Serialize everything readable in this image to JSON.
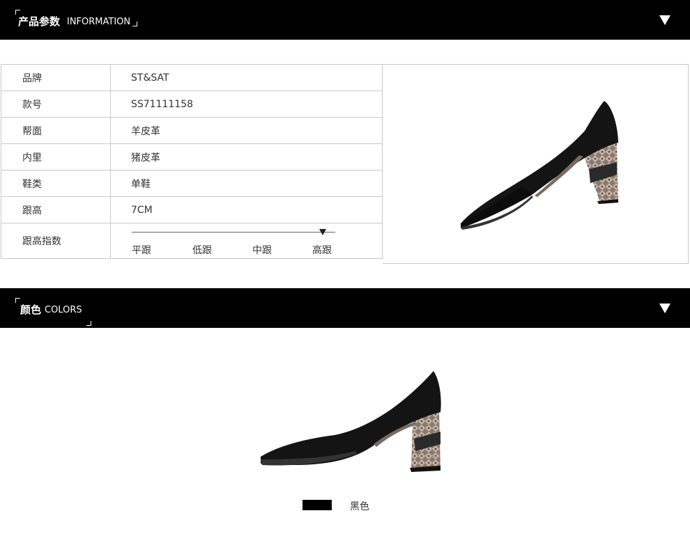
{
  "section_info": {
    "title_cn": "产品参数",
    "title_en": "INFORMATION"
  },
  "specs": [
    {
      "key": "品牌",
      "value": "ST&SAT"
    },
    {
      "key": "款号",
      "value": "SS71111158"
    },
    {
      "key": "帮面",
      "value": "羊皮革"
    },
    {
      "key": "内里",
      "value": "猪皮革"
    },
    {
      "key": "鞋类",
      "value": "单鞋"
    },
    {
      "key": "跟高",
      "value": "7CM"
    }
  ],
  "heel_index": {
    "key": "跟高指数",
    "labels": [
      "平跟",
      "低跟",
      "中跟",
      "高跟"
    ],
    "selected_index": 3
  },
  "section_colors": {
    "title_cn": "颜色",
    "title_en": "COLORS"
  },
  "colors": [
    {
      "name": "黑色",
      "hex": "#000000"
    }
  ],
  "theme": {
    "bar": "#000000",
    "border": "#c8c8c8",
    "text": "#333333"
  },
  "icons": {
    "collapse": "triangle-down-icon"
  }
}
